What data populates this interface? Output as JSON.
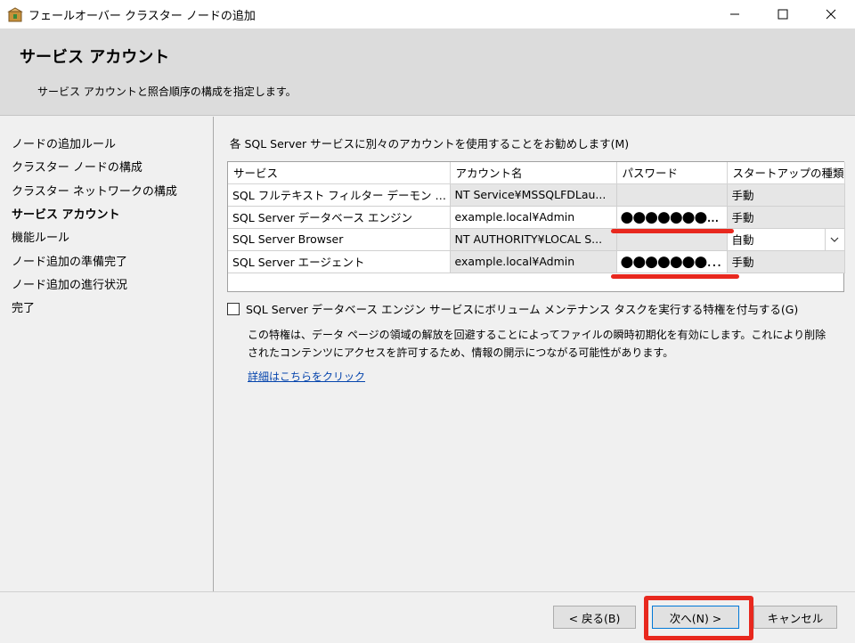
{
  "window": {
    "title": "フェールオーバー クラスター ノードの追加"
  },
  "header": {
    "title": "サービス アカウント",
    "subtitle": "サービス アカウントと照合順序の構成を指定します。"
  },
  "sidebar": {
    "items": [
      {
        "label": "ノードの追加ルール"
      },
      {
        "label": "クラスター ノードの構成"
      },
      {
        "label": "クラスター ネットワークの構成"
      },
      {
        "label": "サービス アカウント"
      },
      {
        "label": "機能ルール"
      },
      {
        "label": "ノード追加の準備完了"
      },
      {
        "label": "ノード追加の進行状況"
      },
      {
        "label": "完了"
      }
    ],
    "active_index": 3
  },
  "main": {
    "instruction": "各 SQL Server サービスに別々のアカウントを使用することをお勧めします(M)",
    "table": {
      "headers": [
        "サービス",
        "アカウント名",
        "パスワード",
        "スタートアップの種類"
      ],
      "rows": [
        {
          "service": "SQL フルテキスト フィルター デーモン ランチ...",
          "account": "NT Service¥MSSQLFDLau...",
          "password": "",
          "startup": "手動"
        },
        {
          "service": "SQL Server データベース エンジン",
          "account": "example.local¥Admin",
          "password": "●●●●●●●...",
          "startup": "手動"
        },
        {
          "service": "SQL Server Browser",
          "account": "NT AUTHORITY¥LOCAL S...",
          "password": "",
          "startup": "自動"
        },
        {
          "service": "SQL Server エージェント",
          "account": "example.local¥Admin",
          "password": "●●●●●●●●●",
          "startup": "手動"
        }
      ]
    },
    "checkbox_label": "SQL Server データベース エンジン サービスにボリューム メンテナンス タスクを実行する特権を付与する(G)",
    "description_line1": "この特権は、データ ページの領域の解放を回避することによってファイルの瞬時初期化を有効にします。これにより削除",
    "description_line2": "されたコンテンツにアクセスを許可するため、情報の開示につながる可能性があります。",
    "link": "詳細はこちらをクリック"
  },
  "footer": {
    "back": "< 戻る(B)",
    "next": "次へ(N) >",
    "cancel": "キャンセル"
  },
  "colors": {
    "annotation_red": "#e8281e",
    "link": "#0645ad"
  }
}
